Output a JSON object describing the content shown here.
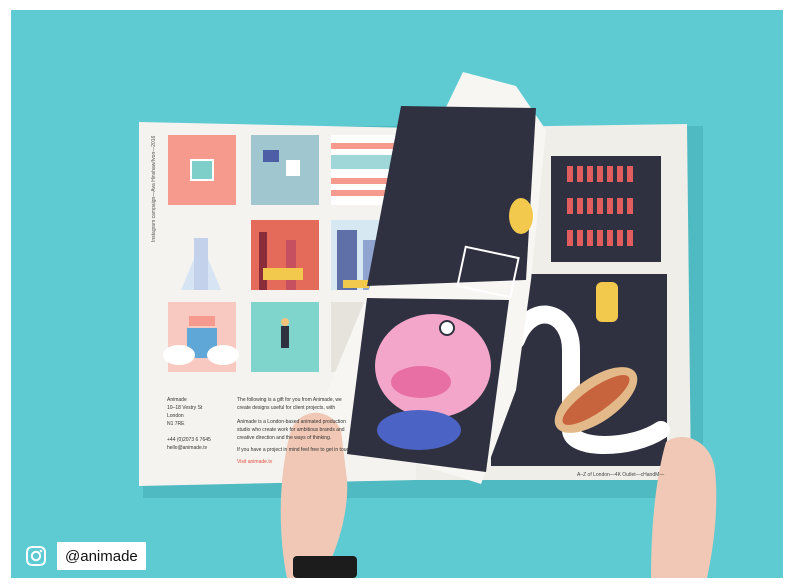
{
  "spread": {
    "vertical_caption": "Instagram campaign—Ava Hinshaw/Ivon—2016",
    "contact": [
      "Animade",
      "10–18 Vestry St",
      "London",
      "N1 7RE",
      "",
      "+44 (0)2073 6 7645",
      "hello@animade.tv"
    ],
    "intro_lines": [
      "The following is a gift for you from Animade, we",
      "create designs useful for client projects, with",
      "",
      "Animade is a London-based animated production",
      "studio who create work for ambitious brands and",
      "creative direction and the ways of thinking.",
      "",
      "If you have a project in mind feel free to get in touch"
    ],
    "link_text": "Visit animade.tv",
    "footer_note": "A–Z of London—4K Outlet—cHandM—"
  },
  "social": {
    "icon": "instagram-icon",
    "handle": "@animade"
  },
  "colors": {
    "background": "#5ecbd3",
    "paper": "#f4f3ef",
    "dark_panel": "#2f3140"
  }
}
